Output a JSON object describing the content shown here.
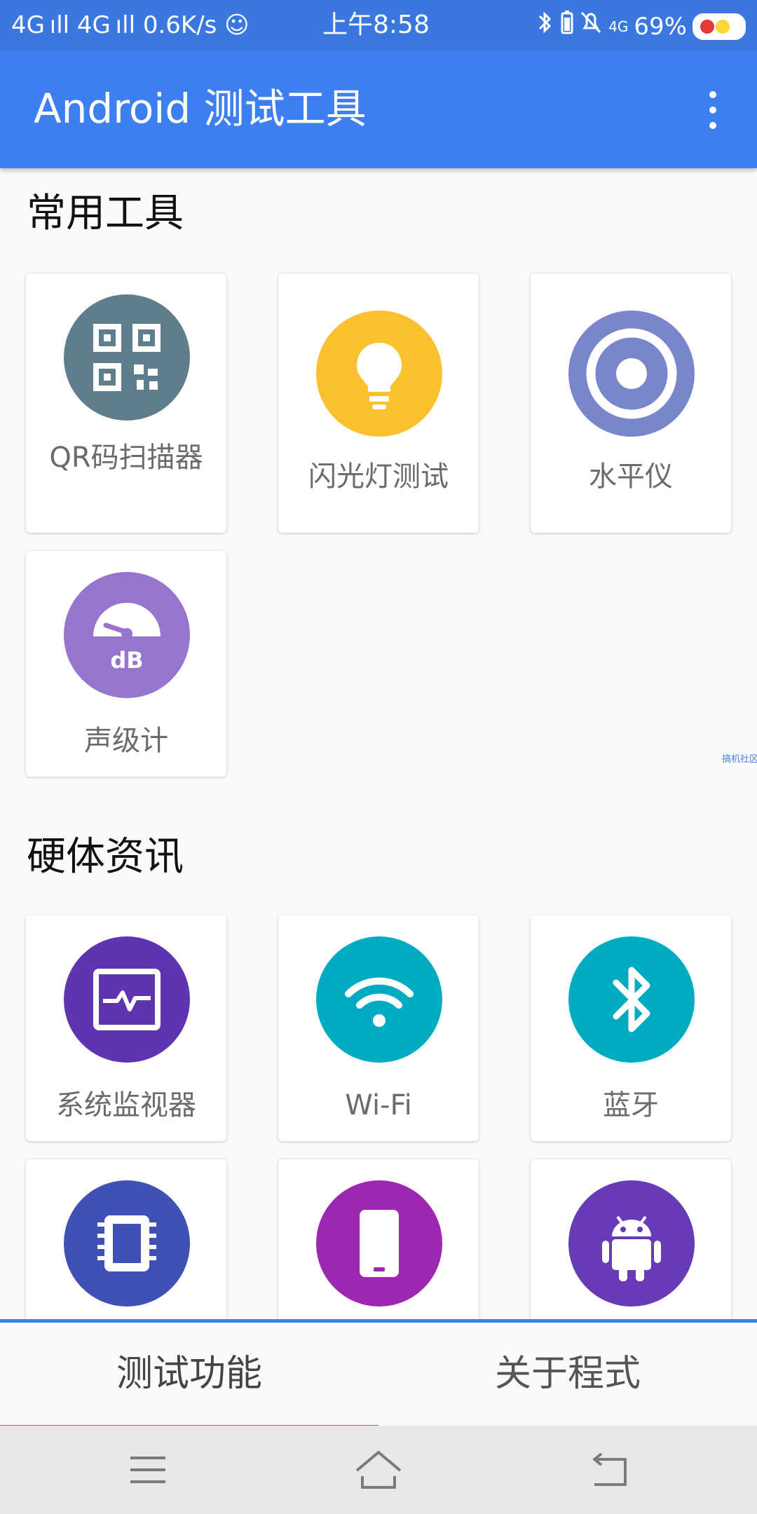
{
  "status_bar": {
    "left": "4G ıll  4G ıll 0.6K/s ☺",
    "time": "上午8:58",
    "battery_percent": "69%"
  },
  "app_bar": {
    "title": "Android 测试工具"
  },
  "sections": [
    {
      "title": "常用工具",
      "items": [
        {
          "label": "QR码扫描器",
          "icon": "qr-code-icon",
          "color": "#607d8b"
        },
        {
          "label": "闪光灯测试",
          "icon": "lightbulb-icon",
          "color": "#fbc02d"
        },
        {
          "label": "水平仪",
          "icon": "level-target-icon",
          "color": "#7986cb"
        },
        {
          "label": "声级计",
          "icon": "sound-meter-icon",
          "color": "#9575cd",
          "icon_text": "dB"
        }
      ]
    },
    {
      "title": "硬体资讯",
      "items": [
        {
          "label": "系统监视器",
          "icon": "system-monitor-icon",
          "color": "#5e35b1"
        },
        {
          "label": "Wi-Fi",
          "icon": "wifi-icon",
          "color": "#00acc1"
        },
        {
          "label": "蓝牙",
          "icon": "bluetooth-icon",
          "color": "#00acc1"
        },
        {
          "label": "",
          "icon": "memory-chip-icon",
          "color": "#3f51b5"
        },
        {
          "label": "",
          "icon": "phone-device-icon",
          "color": "#9c27b0"
        },
        {
          "label": "",
          "icon": "android-icon",
          "color": "#673ab7"
        }
      ]
    }
  ],
  "watermark": "搞机社区",
  "tabs": [
    {
      "label": "测试功能",
      "selected": true
    },
    {
      "label": "关于程式",
      "selected": false
    }
  ],
  "colors": {
    "status_bar": "#3a78e0",
    "app_bar": "#3d7ff0",
    "accent": "#3d7ff0"
  }
}
